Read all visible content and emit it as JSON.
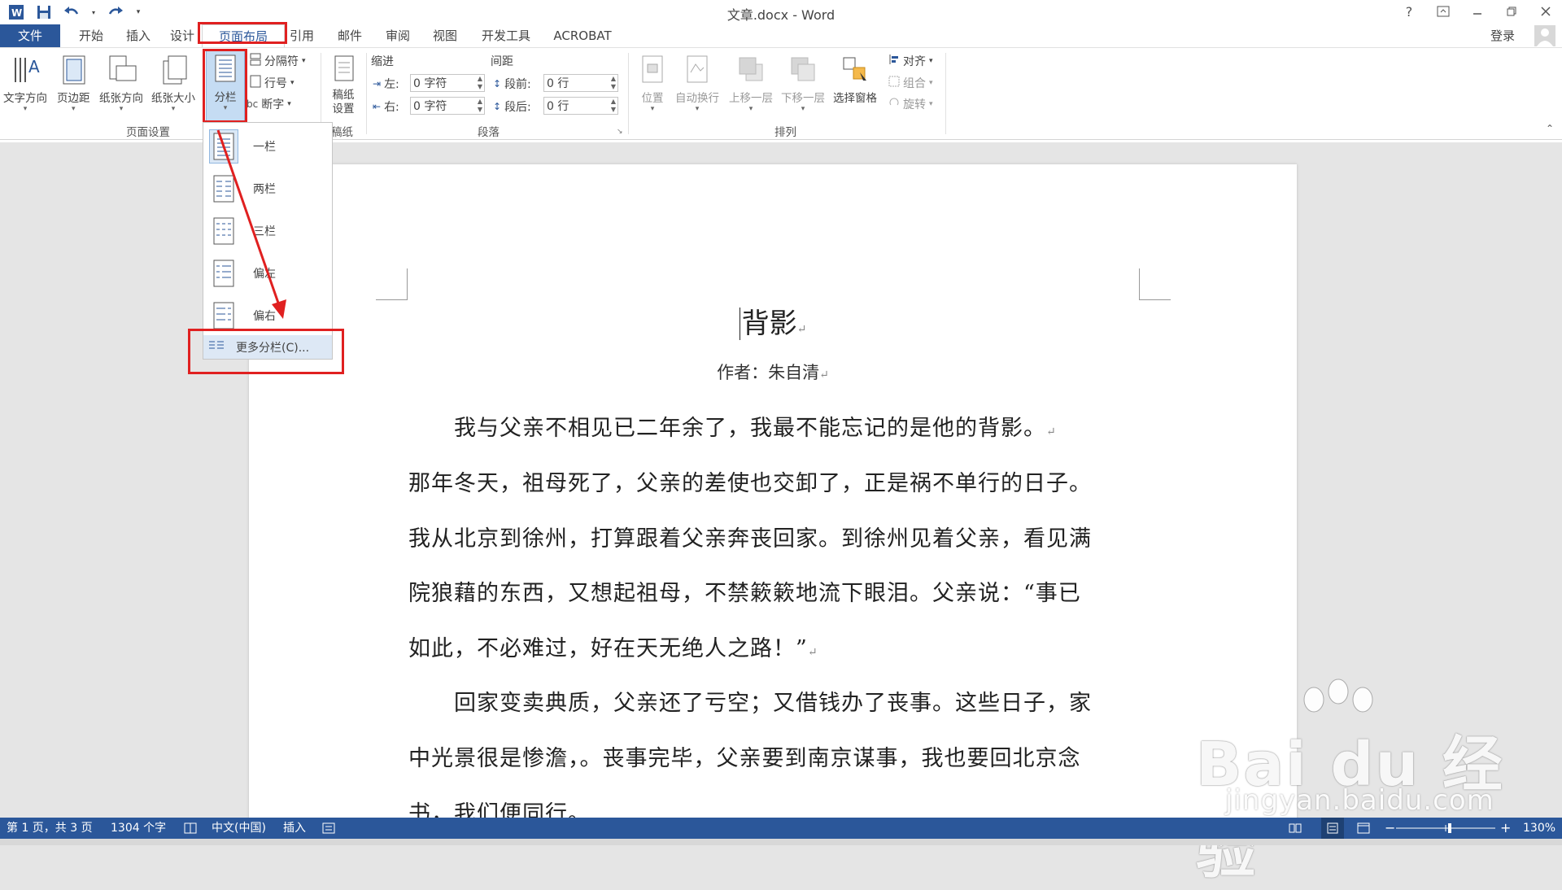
{
  "app": {
    "doc_title": "文章.docx - Word",
    "help": "?",
    "login": "登录"
  },
  "tabs": [
    "文件",
    "开始",
    "插入",
    "设计",
    "页面布局",
    "引用",
    "邮件",
    "审阅",
    "视图",
    "开发工具",
    "ACROBAT"
  ],
  "ribbon": {
    "page_setup": {
      "text_direction": "文字方向",
      "margins": "页边距",
      "orientation": "纸张方向",
      "size": "纸张大小",
      "columns": "分栏",
      "breaks": "分隔符",
      "line_numbers": "行号",
      "hyphenation": "断字",
      "group_label": "页面设置"
    },
    "manuscript": {
      "button": "稿纸\n设置",
      "button_l1": "稿纸",
      "button_l2": "设置",
      "group_label": "稿纸"
    },
    "paragraph": {
      "indent_label": "缩进",
      "spacing_label": "间距",
      "left_label": "左:",
      "left_value": "0 字符",
      "right_label": "右:",
      "right_value": "0 字符",
      "before_label": "段前:",
      "before_value": "0 行",
      "after_label": "段后:",
      "after_value": "0 行",
      "group_label": "段落"
    },
    "arrange": {
      "position": "位置",
      "wrap_text": "自动换行",
      "bring_forward": "上移一层",
      "send_backward": "下移一层",
      "selection_pane": "选择窗格",
      "align": "对齐",
      "group": "组合",
      "rotate": "旋转",
      "group_label": "排列"
    }
  },
  "columns_menu": {
    "options": [
      "一栏",
      "两栏",
      "三栏",
      "偏左",
      "偏右"
    ],
    "more": "更多分栏(C)..."
  },
  "document": {
    "heading": "背影",
    "author": "作者：朱自清",
    "lines": [
      "　　我与父亲不相见已二年余了，我最不能忘记的是他的背影。",
      "那年冬天，祖母死了，父亲的差使也交卸了，正是祸不单行的日子。",
      "我从北京到徐州，打算跟着父亲奔丧回家。到徐州见着父亲，看见满",
      "院狼藉的东西，又想起祖母，不禁簌簌地流下眼泪。父亲说：“事已",
      "如此，不必难过，好在天无绝人之路！”",
      "　　回家变卖典质，父亲还了亏空；又借钱办了丧事。这些日子，家",
      "中光景很是惨澹，。丧事完毕，父亲要到南京谋事，我也要回北京念",
      "书，我们便同行。"
    ]
  },
  "statusbar": {
    "page": "第 1 页，共 3 页",
    "words": "1304 个字",
    "language": "中文(中国)",
    "mode": "插入",
    "zoom": "130%"
  },
  "watermark": {
    "main": "Bai du 经验",
    "sub": "jingyan.baidu.com"
  },
  "colors": {
    "accent": "#2b579a",
    "highlight": "#e02020",
    "selected": "#c5dcf3"
  }
}
